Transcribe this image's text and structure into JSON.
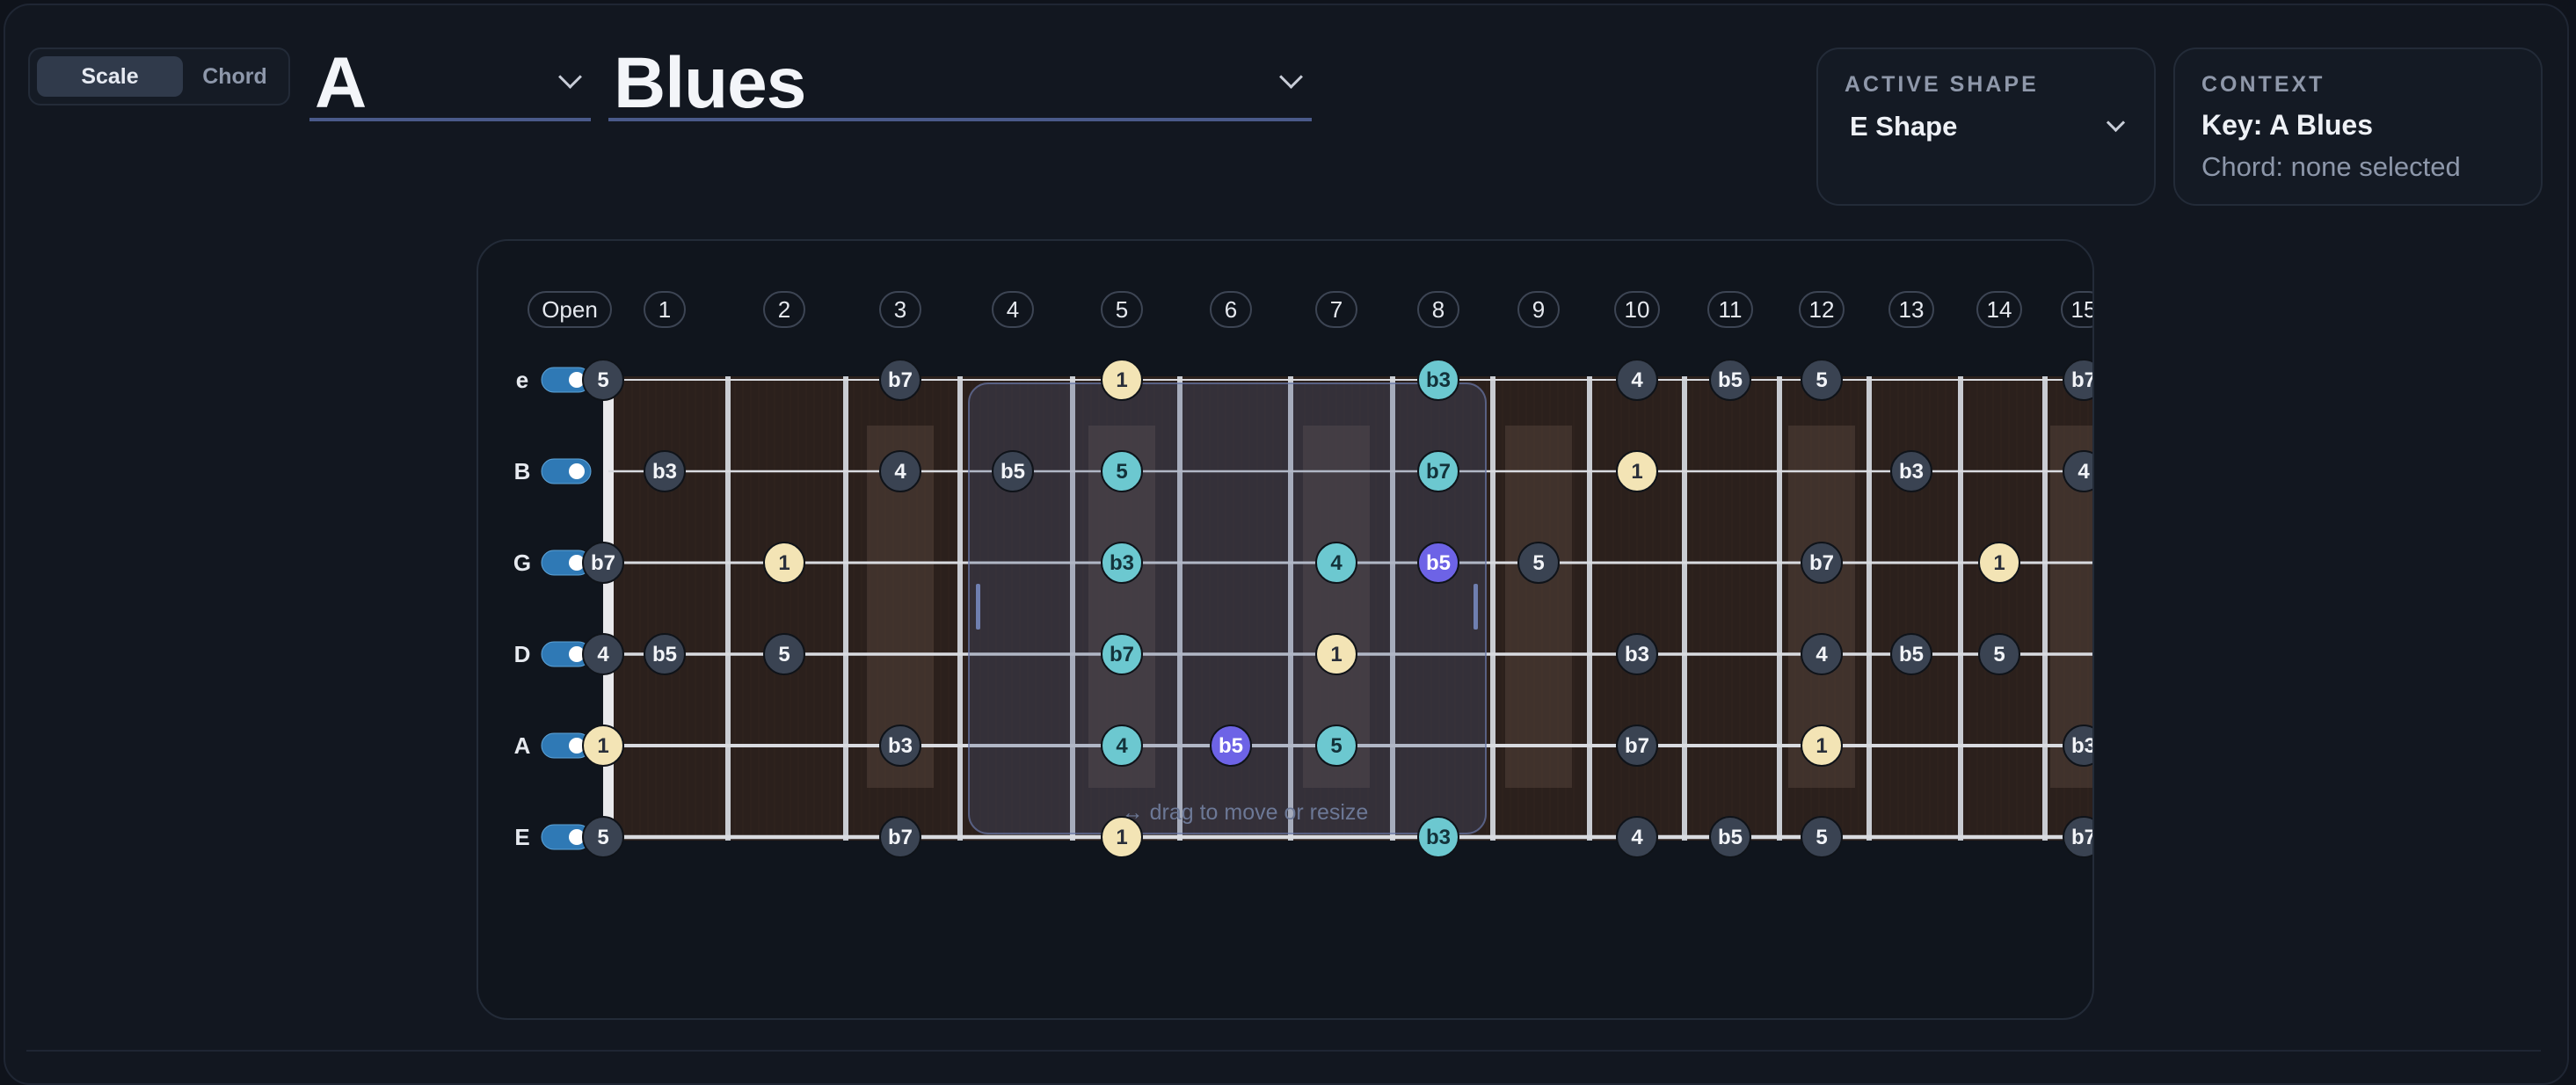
{
  "mode_toggle": {
    "scale_label": "Scale",
    "chord_label": "Chord",
    "selected": "Scale"
  },
  "key_select": {
    "value": "A"
  },
  "scale_select": {
    "value": "Blues"
  },
  "active_shape": {
    "label": "ACTIVE SHAPE",
    "value": "E Shape"
  },
  "context": {
    "label": "CONTEXT",
    "key_text": "Key: A Blues",
    "chord_text": "Chord: none selected"
  },
  "fretboard": {
    "fret_labels": [
      "Open",
      "1",
      "2",
      "3",
      "4",
      "5",
      "6",
      "7",
      "8",
      "9",
      "10",
      "11",
      "12",
      "13",
      "14",
      "15"
    ],
    "strings": [
      {
        "name": "e",
        "enabled": true
      },
      {
        "name": "B",
        "enabled": true
      },
      {
        "name": "G",
        "enabled": true
      },
      {
        "name": "D",
        "enabled": true
      },
      {
        "name": "A",
        "enabled": true
      },
      {
        "name": "E",
        "enabled": true
      }
    ],
    "shape_overlay": {
      "from_fret": 4,
      "to_fret": 8,
      "hint": "↔ drag to move or resize"
    },
    "notes": [
      {
        "string": 0,
        "fret": 0,
        "degree": "5"
      },
      {
        "string": 0,
        "fret": 3,
        "degree": "b7"
      },
      {
        "string": 0,
        "fret": 5,
        "degree": "1"
      },
      {
        "string": 0,
        "fret": 8,
        "degree": "b3"
      },
      {
        "string": 0,
        "fret": 10,
        "degree": "4"
      },
      {
        "string": 0,
        "fret": 11,
        "degree": "b5"
      },
      {
        "string": 0,
        "fret": 12,
        "degree": "5"
      },
      {
        "string": 0,
        "fret": 15,
        "degree": "b7"
      },
      {
        "string": 1,
        "fret": 1,
        "degree": "b3"
      },
      {
        "string": 1,
        "fret": 3,
        "degree": "4"
      },
      {
        "string": 1,
        "fret": 4,
        "degree": "b5"
      },
      {
        "string": 1,
        "fret": 5,
        "degree": "5"
      },
      {
        "string": 1,
        "fret": 8,
        "degree": "b7"
      },
      {
        "string": 1,
        "fret": 10,
        "degree": "1"
      },
      {
        "string": 1,
        "fret": 13,
        "degree": "b3"
      },
      {
        "string": 1,
        "fret": 15,
        "degree": "4"
      },
      {
        "string": 2,
        "fret": 0,
        "degree": "b7"
      },
      {
        "string": 2,
        "fret": 2,
        "degree": "1"
      },
      {
        "string": 2,
        "fret": 5,
        "degree": "b3"
      },
      {
        "string": 2,
        "fret": 7,
        "degree": "4"
      },
      {
        "string": 2,
        "fret": 8,
        "degree": "b5"
      },
      {
        "string": 2,
        "fret": 9,
        "degree": "5"
      },
      {
        "string": 2,
        "fret": 12,
        "degree": "b7"
      },
      {
        "string": 2,
        "fret": 14,
        "degree": "1"
      },
      {
        "string": 3,
        "fret": 0,
        "degree": "4"
      },
      {
        "string": 3,
        "fret": 1,
        "degree": "b5"
      },
      {
        "string": 3,
        "fret": 2,
        "degree": "5"
      },
      {
        "string": 3,
        "fret": 5,
        "degree": "b7"
      },
      {
        "string": 3,
        "fret": 7,
        "degree": "1"
      },
      {
        "string": 3,
        "fret": 10,
        "degree": "b3"
      },
      {
        "string": 3,
        "fret": 12,
        "degree": "4"
      },
      {
        "string": 3,
        "fret": 13,
        "degree": "b5"
      },
      {
        "string": 3,
        "fret": 14,
        "degree": "5"
      },
      {
        "string": 4,
        "fret": 0,
        "degree": "1"
      },
      {
        "string": 4,
        "fret": 3,
        "degree": "b3"
      },
      {
        "string": 4,
        "fret": 5,
        "degree": "4"
      },
      {
        "string": 4,
        "fret": 6,
        "degree": "b5"
      },
      {
        "string": 4,
        "fret": 7,
        "degree": "5"
      },
      {
        "string": 4,
        "fret": 10,
        "degree": "b7"
      },
      {
        "string": 4,
        "fret": 12,
        "degree": "1"
      },
      {
        "string": 4,
        "fret": 15,
        "degree": "b3"
      },
      {
        "string": 5,
        "fret": 0,
        "degree": "5"
      },
      {
        "string": 5,
        "fret": 3,
        "degree": "b7"
      },
      {
        "string": 5,
        "fret": 5,
        "degree": "1"
      },
      {
        "string": 5,
        "fret": 8,
        "degree": "b3"
      },
      {
        "string": 5,
        "fret": 10,
        "degree": "4"
      },
      {
        "string": 5,
        "fret": 11,
        "degree": "b5"
      },
      {
        "string": 5,
        "fret": 12,
        "degree": "5"
      },
      {
        "string": 5,
        "fret": 15,
        "degree": "b7"
      }
    ]
  },
  "colors": {
    "root": "#f3e4b5",
    "blue_note": "#6d63e6",
    "in_shape": "#6cc8d0",
    "default_note": "#3a4352",
    "wood": "#2b201c",
    "toggle_on": "#2f79b5"
  }
}
